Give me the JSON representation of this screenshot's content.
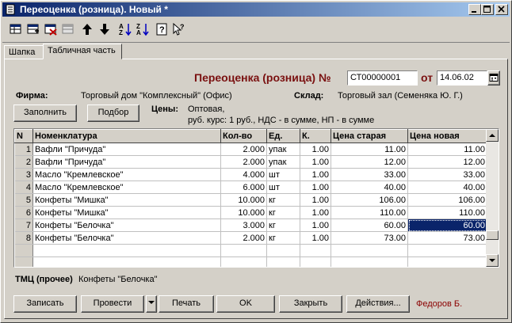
{
  "window": {
    "title": "Переоценка (розница). Новый *"
  },
  "tabs": [
    {
      "label": "Шапка"
    },
    {
      "label": "Табличная часть"
    }
  ],
  "doc": {
    "title": "Переоценка (розница) №",
    "number": "СТ00000001",
    "date_label": "от",
    "date": "14.06.02"
  },
  "firm": {
    "label": "Фирма:",
    "value": "Торговый дом \"Комплексный\" (Офис)"
  },
  "warehouse": {
    "label": "Склад:",
    "value": "Торговый зал (Семеняка Ю. Г.)"
  },
  "buttons": {
    "fill": "Заполнить",
    "select": "Подбор"
  },
  "prices": {
    "label": "Цены:",
    "line1": "Оптовая,",
    "line2": "руб. курс: 1 руб., НДС - в сумме, НП - в сумме"
  },
  "table": {
    "columns": [
      "N",
      "Номенклатура",
      "Кол-во",
      "Ед.",
      "К.",
      "Цена старая",
      "Цена новая"
    ],
    "rows": [
      {
        "n": "1",
        "name": "Вафли \"Причуда\"",
        "qty": "2.000",
        "unit": "упак",
        "k": "1.00",
        "old": "11.00",
        "new": "11.00"
      },
      {
        "n": "2",
        "name": "Вафли \"Причуда\"",
        "qty": "2.000",
        "unit": "упак",
        "k": "1.00",
        "old": "12.00",
        "new": "12.00"
      },
      {
        "n": "3",
        "name": "Масло \"Кремлевское\"",
        "qty": "4.000",
        "unit": "шт",
        "k": "1.00",
        "old": "33.00",
        "new": "33.00"
      },
      {
        "n": "4",
        "name": "Масло \"Кремлевское\"",
        "qty": "6.000",
        "unit": "шт",
        "k": "1.00",
        "old": "40.00",
        "new": "40.00"
      },
      {
        "n": "5",
        "name": "Конфеты \"Мишка\"",
        "qty": "10.000",
        "unit": "кг",
        "k": "1.00",
        "old": "106.00",
        "new": "106.00"
      },
      {
        "n": "6",
        "name": "Конфеты \"Мишка\"",
        "qty": "10.000",
        "unit": "кг",
        "k": "1.00",
        "old": "110.00",
        "new": "110.00"
      },
      {
        "n": "7",
        "name": "Конфеты \"Белочка\"",
        "qty": "3.000",
        "unit": "кг",
        "k": "1.00",
        "old": "60.00",
        "new": "60.00"
      },
      {
        "n": "8",
        "name": "Конфеты \"Белочка\"",
        "qty": "2.000",
        "unit": "кг",
        "k": "1.00",
        "old": "73.00",
        "new": "73.00"
      }
    ],
    "selected_row": 7,
    "selected_column": "new"
  },
  "status": {
    "label": "ТМЦ (прочее)",
    "value": "Конфеты \"Белочка\""
  },
  "footer": {
    "save": "Записать",
    "post": "Провести",
    "print": "Печать",
    "ok": "OK",
    "close": "Закрыть",
    "actions": "Действия...",
    "user": "Федоров Б."
  },
  "toolbar_icons": [
    "new-row-icon",
    "copy-row-icon",
    "delete-row-icon",
    "edit-row-icon",
    "arrow-up-icon",
    "arrow-down-icon",
    "sort-asc-icon",
    "sort-desc-icon",
    "help-icon",
    "context-help-icon"
  ],
  "colors": {
    "title_gradient_start": "#0a246a",
    "title_gradient_end": "#a6caf0",
    "doc_title": "#7a1010",
    "user": "#8b0000",
    "selection": "#0a246a"
  }
}
